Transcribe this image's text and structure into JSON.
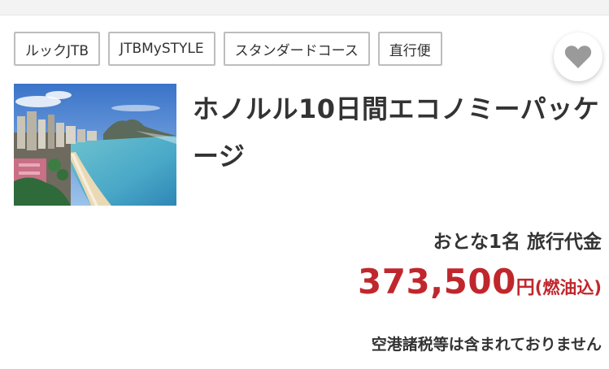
{
  "tags": [
    "ルックJTB",
    "JTBMySTYLE",
    "スタンダードコース",
    "直行便"
  ],
  "favorite": {
    "icon": "heart-icon",
    "active": false
  },
  "photo": {
    "subject": "honolulu-beach-photo"
  },
  "title": "ホノルル10日間エコノミーパッケージ",
  "price": {
    "label": "おとな1名 旅行代金",
    "amount": "373,500",
    "unit": "円",
    "note": "(燃油込)",
    "tax_note": "空港諸税等は含まれておりません",
    "color": "#c0272d"
  }
}
